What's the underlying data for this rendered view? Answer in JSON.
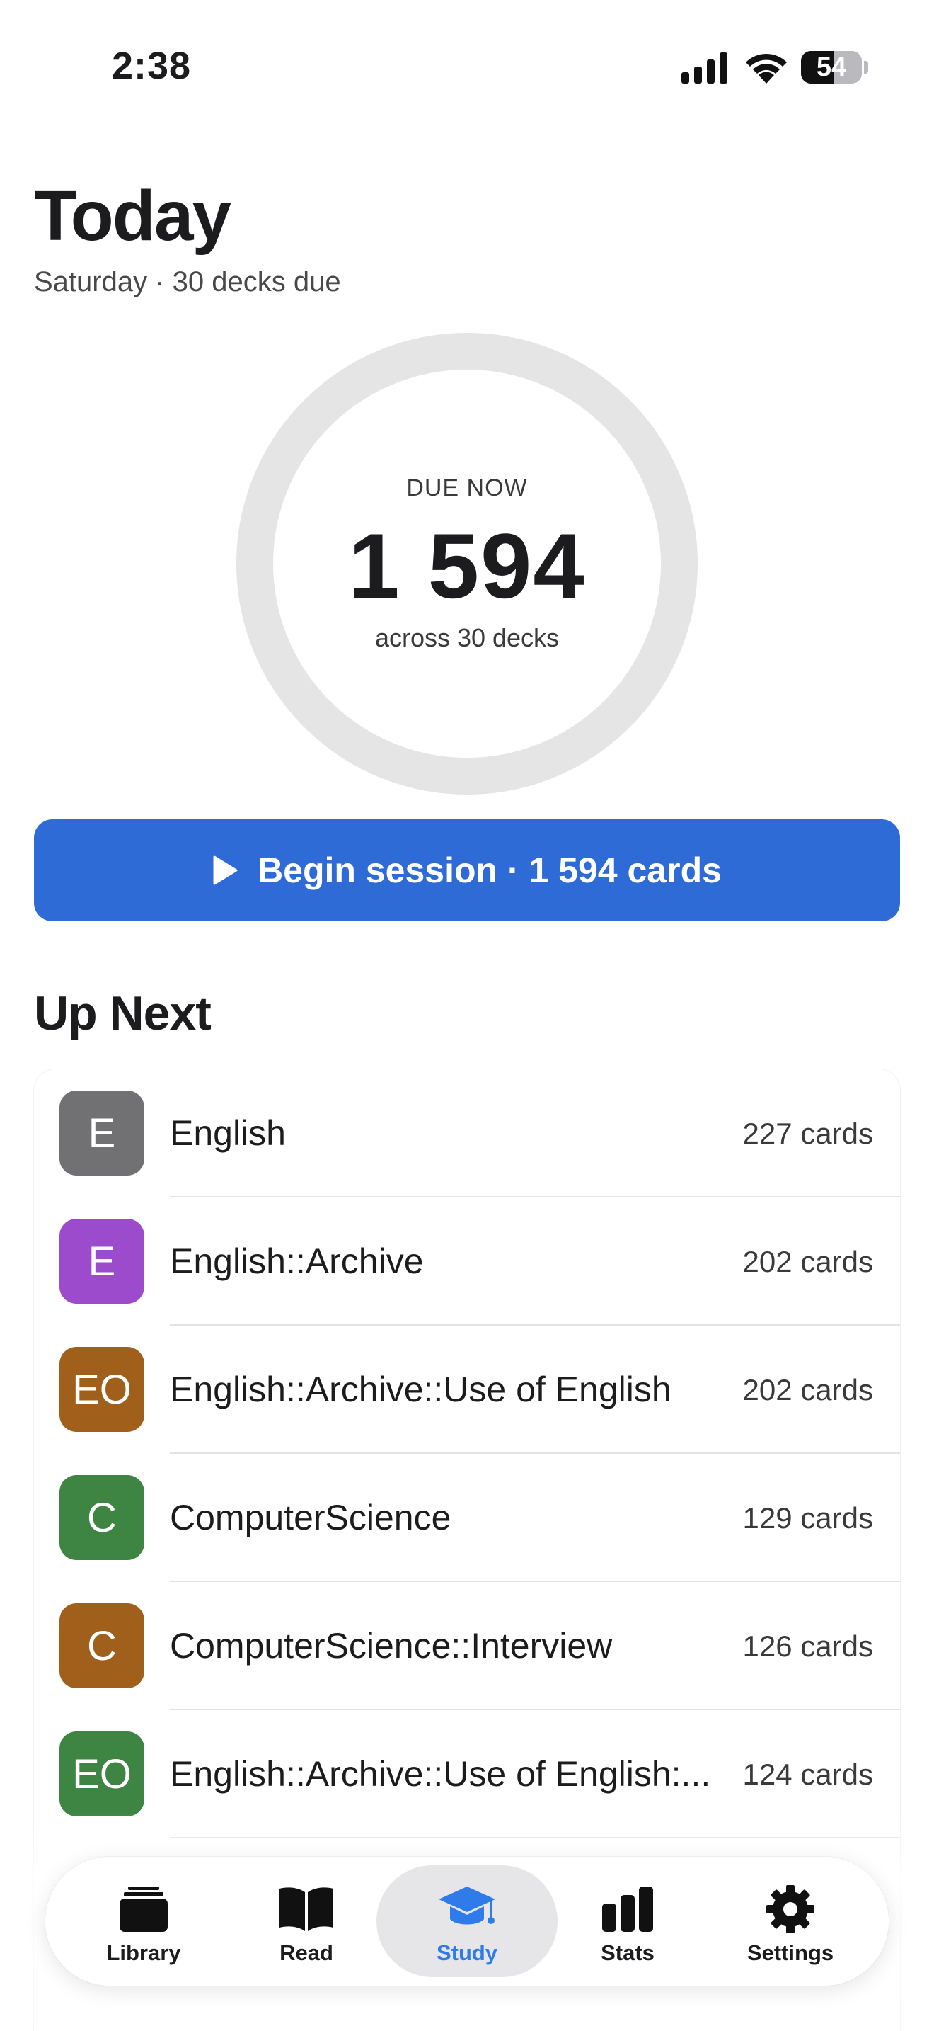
{
  "status_bar": {
    "time": "2:38",
    "battery_level": "54",
    "battery_fraction": 0.54
  },
  "header": {
    "title": "Today",
    "subtitle": "Saturday · 30 decks due"
  },
  "summary": {
    "label": "DUE NOW",
    "count": "1 594",
    "caption": "across 30 decks"
  },
  "begin_button": {
    "label": "Begin session · 1 594 cards",
    "icon": "play-icon"
  },
  "up_next": {
    "title": "Up Next",
    "decks": [
      {
        "initials": "E",
        "name": "English",
        "count": "227 cards",
        "color": "#717174"
      },
      {
        "initials": "E",
        "name": "English::Archive",
        "count": "202 cards",
        "color": "#9b4bcc"
      },
      {
        "initials": "EO",
        "name": "English::Archive::Use of English",
        "count": "202 cards",
        "color": "#a0601c"
      },
      {
        "initials": "C",
        "name": "ComputerScience",
        "count": "129 cards",
        "color": "#3e8543"
      },
      {
        "initials": "C",
        "name": "ComputerScience::Interview",
        "count": "126 cards",
        "color": "#a0601c"
      },
      {
        "initials": "EO",
        "name": "English::Archive::Use of English:...",
        "count": "124 cards",
        "color": "#3e8543"
      }
    ]
  },
  "tab_bar": {
    "tabs": [
      {
        "label": "Library",
        "icon": "library-stack-icon",
        "active": false
      },
      {
        "label": "Read",
        "icon": "open-book-icon",
        "active": false
      },
      {
        "label": "Study",
        "icon": "graduation-cap-icon",
        "active": true
      },
      {
        "label": "Stats",
        "icon": "bar-chart-icon",
        "active": false
      },
      {
        "label": "Settings",
        "icon": "gear-icon",
        "active": false
      }
    ],
    "active_color": "#2f7be9"
  },
  "colors": {
    "accent": "#2f6bd6",
    "ring": "#e5e5e5"
  }
}
